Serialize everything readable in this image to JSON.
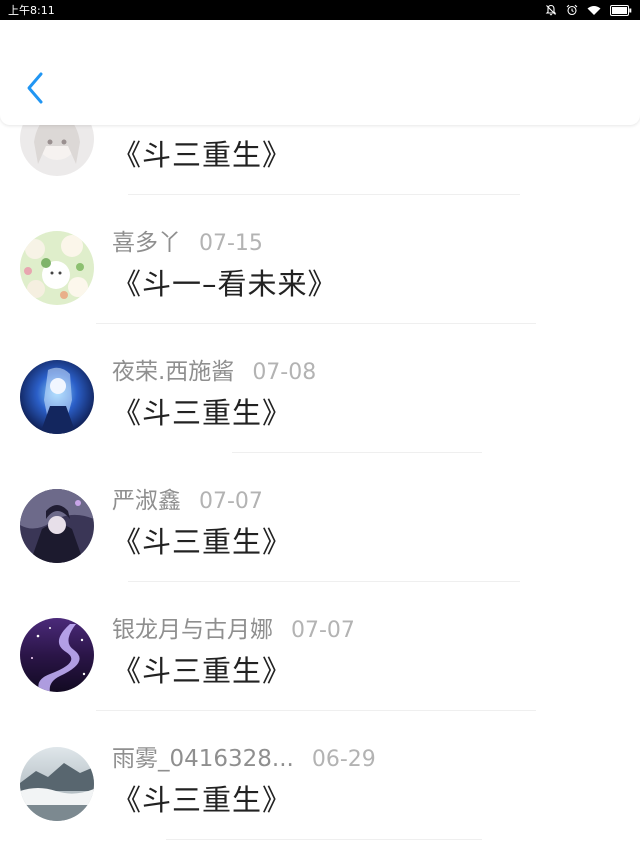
{
  "status_bar": {
    "time": "上午8:11",
    "icons": [
      "mute-bell-icon",
      "alarm-clock-icon",
      "wifi-icon",
      "battery-icon"
    ]
  },
  "header": {
    "back_icon": "chevron-left-icon",
    "accent_color": "#2196F3"
  },
  "list": {
    "items": [
      {
        "author": "",
        "date": "",
        "title": "《斗三重生》",
        "avatar": "white-hair-anime-girl"
      },
      {
        "author": "喜多丫",
        "date": "07-15",
        "title": "《斗一–看未来》",
        "avatar": "cartoon-sheep-collage"
      },
      {
        "author": "夜荣.西施酱",
        "date": "07-08",
        "title": "《斗三重生》",
        "avatar": "blue-glowing-anime-warrior"
      },
      {
        "author": "严淑鑫",
        "date": "07-07",
        "title": "《斗三重生》",
        "avatar": "dark-anime-character"
      },
      {
        "author": "银龙月与古月娜",
        "date": "07-07",
        "title": "《斗三重生》",
        "avatar": "purple-galaxy-river"
      },
      {
        "author": "雨雾_0416328...",
        "date": "06-29",
        "title": "《斗三重生》",
        "avatar": "misty-mountain-landscape"
      }
    ]
  }
}
